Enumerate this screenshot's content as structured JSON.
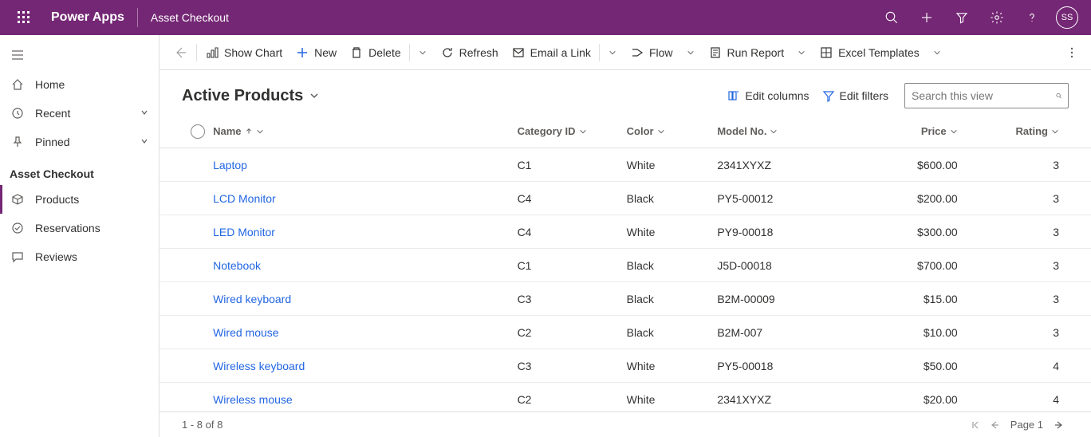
{
  "header": {
    "brand": "Power Apps",
    "page": "Asset Checkout",
    "avatar": "SS"
  },
  "sidebar": {
    "home": "Home",
    "recent": "Recent",
    "pinned": "Pinned",
    "section": "Asset Checkout",
    "items": [
      {
        "label": "Products"
      },
      {
        "label": "Reservations"
      },
      {
        "label": "Reviews"
      }
    ]
  },
  "commandbar": {
    "show_chart": "Show Chart",
    "new": "New",
    "delete": "Delete",
    "refresh": "Refresh",
    "email_link": "Email a Link",
    "flow": "Flow",
    "run_report": "Run Report",
    "excel_templates": "Excel Templates"
  },
  "view": {
    "title": "Active Products",
    "edit_columns": "Edit columns",
    "edit_filters": "Edit filters",
    "search_placeholder": "Search this view"
  },
  "columns": {
    "name": "Name",
    "category": "Category ID",
    "color": "Color",
    "model": "Model No.",
    "price": "Price",
    "rating": "Rating"
  },
  "rows": [
    {
      "name": "Laptop",
      "category": "C1",
      "color": "White",
      "model": "2341XYXZ",
      "price": "$600.00",
      "rating": "3"
    },
    {
      "name": "LCD Monitor",
      "category": "C4",
      "color": "Black",
      "model": "PY5-00012",
      "price": "$200.00",
      "rating": "3"
    },
    {
      "name": "LED Monitor",
      "category": "C4",
      "color": "White",
      "model": "PY9-00018",
      "price": "$300.00",
      "rating": "3"
    },
    {
      "name": "Notebook",
      "category": "C1",
      "color": "Black",
      "model": "J5D-00018",
      "price": "$700.00",
      "rating": "3"
    },
    {
      "name": "Wired keyboard",
      "category": "C3",
      "color": "Black",
      "model": "B2M-00009",
      "price": "$15.00",
      "rating": "3"
    },
    {
      "name": "Wired mouse",
      "category": "C2",
      "color": "Black",
      "model": "B2M-007",
      "price": "$10.00",
      "rating": "3"
    },
    {
      "name": "Wireless keyboard",
      "category": "C3",
      "color": "White",
      "model": "PY5-00018",
      "price": "$50.00",
      "rating": "4"
    },
    {
      "name": "Wireless mouse",
      "category": "C2",
      "color": "White",
      "model": "2341XYXZ",
      "price": "$20.00",
      "rating": "4"
    }
  ],
  "footer": {
    "count": "1 - 8 of 8",
    "page": "Page 1"
  }
}
